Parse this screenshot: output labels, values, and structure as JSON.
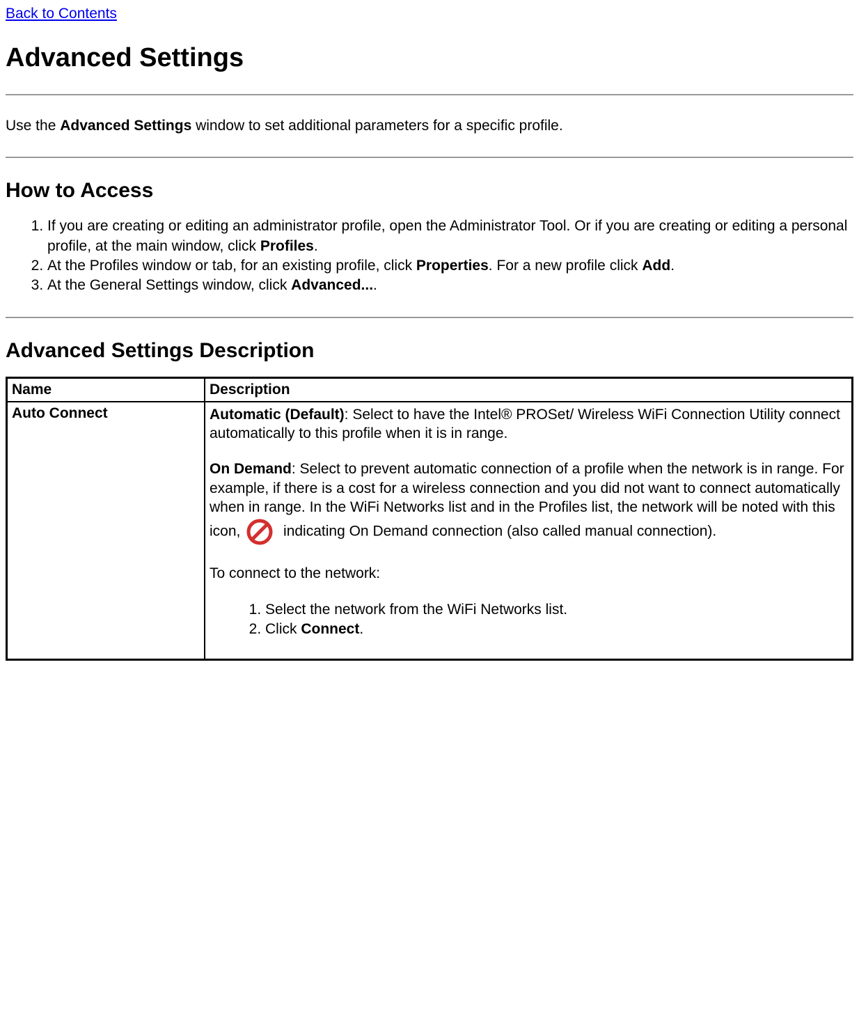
{
  "back_link": "Back to Contents",
  "h1": "Advanced Settings",
  "intro_pre": "Use the ",
  "intro_bold": "Advanced Settings",
  "intro_post": " window to set additional parameters for a specific profile.",
  "how_to_access": {
    "heading": "How to Access",
    "steps": {
      "s1_pre": "If you are creating or editing an administrator profile, open the Administrator Tool. Or if you are creating or editing a personal profile, at the main window, click ",
      "s1_bold": "Profiles",
      "s1_post": ".",
      "s2_pre": "At the Profiles window or tab, for an existing profile, click ",
      "s2_bold1": "Properties",
      "s2_mid": ". For a new profile click ",
      "s2_bold2": "Add",
      "s2_post": ".",
      "s3_pre": "At the General Settings window, click ",
      "s3_bold": "Advanced...",
      "s3_post": "."
    }
  },
  "description": {
    "heading": "Advanced Settings Description",
    "th_name": "Name",
    "th_desc": "Description",
    "row1": {
      "name": "Auto Connect",
      "auto_bold": "Automatic (Default)",
      "auto_text": ": Select to have the Intel® PROSet/ Wireless WiFi Connection Utility connect automatically to this profile when it is in range.",
      "ondemand_bold": "On Demand",
      "ondemand_text": ": Select to prevent automatic connection of a profile when the network is in range. For example, if there is a cost for a wireless connection and you did not want to connect automatically when in range. In the WiFi Networks list and in the Profiles list, the network will be noted with this icon, ",
      "ondemand_after_icon": " indicating On Demand connection (also called manual connection).",
      "connect_intro": "To connect to the network:",
      "connect_steps": {
        "s1": "Select the network from the WiFi Networks list.",
        "s2_pre": "Click ",
        "s2_bold": "Connect",
        "s2_post": "."
      }
    }
  }
}
